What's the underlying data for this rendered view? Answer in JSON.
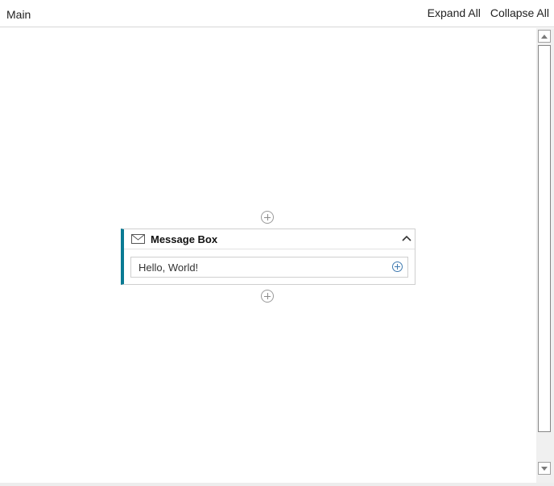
{
  "header": {
    "breadcrumb": "Main",
    "expand_all": "Expand All",
    "collapse_all": "Collapse All"
  },
  "activity": {
    "title": "Message Box",
    "icon": "envelope-icon",
    "message_value": "Hello, World!",
    "accent_color": "#0a7a93"
  }
}
